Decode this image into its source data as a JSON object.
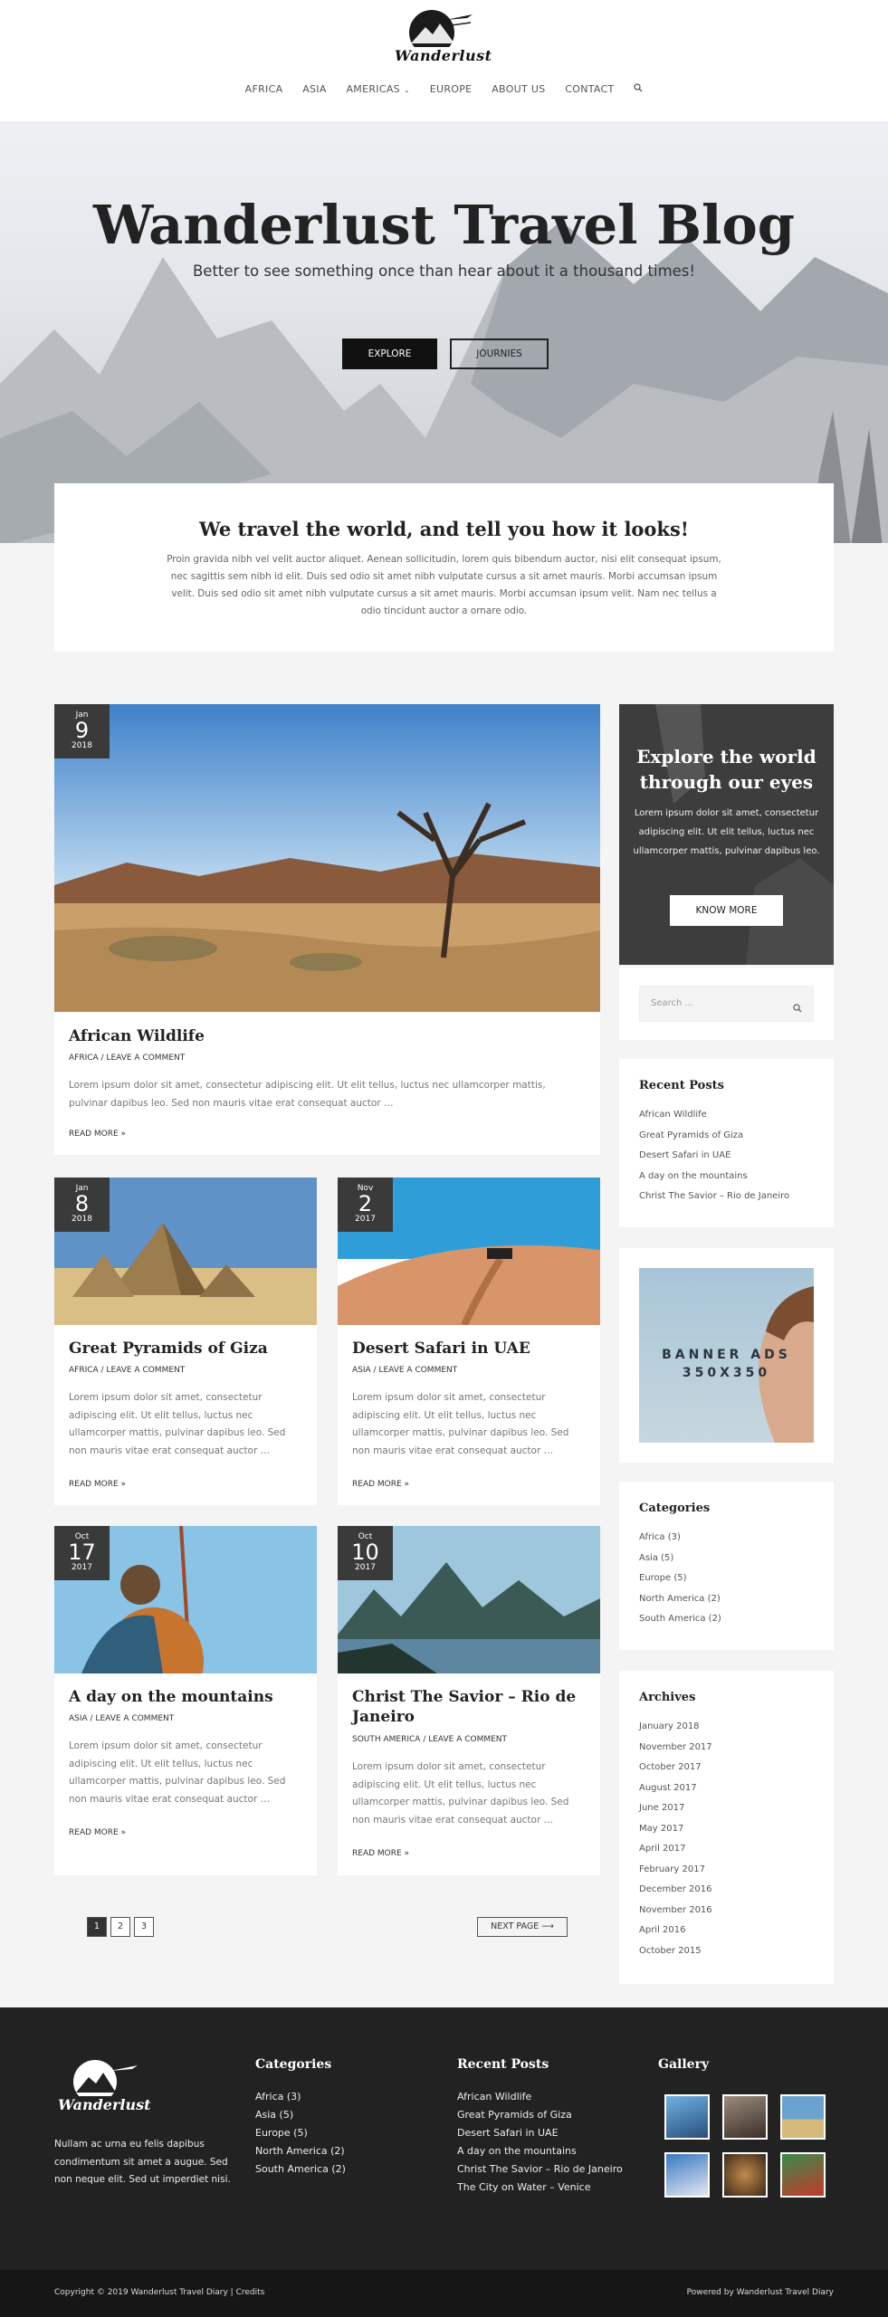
{
  "header": {
    "logo_text": "Wanderlust",
    "nav": [
      {
        "label": "AFRICA"
      },
      {
        "label": "ASIA"
      },
      {
        "label": "AMERICAS"
      },
      {
        "label": "EUROPE"
      },
      {
        "label": "ABOUT US"
      },
      {
        "label": "CONTACT"
      }
    ]
  },
  "hero": {
    "title": "Wanderlust Travel Blog",
    "subtitle": "Better to see something once than hear about it a thousand times!",
    "btn_primary": "EXPLORE",
    "btn_secondary": "JOURNIES"
  },
  "intro": {
    "title": "We travel the world, and tell you how it looks!",
    "text": "Proin gravida nibh vel velit auctor aliquet. Aenean sollicitudin, lorem quis bibendum auctor, nisi elit consequat ipsum, nec sagittis sem nibh id elit. Duis sed odio sit amet nibh vulputate cursus a sit amet mauris. Morbi accumsan ipsum velit. Duis sed odio sit amet nibh vulputate cursus a sit amet mauris. Morbi accumsan ipsum velit. Nam nec tellus a odio tincidunt auctor a ornare odio."
  },
  "posts": [
    {
      "month": "Jan",
      "day": "9",
      "year": "2018",
      "title": "African Wildlife",
      "meta": "AFRICA / LEAVE A COMMENT",
      "excerpt": "Lorem ipsum dolor sit amet, consectetur adipiscing elit. Ut elit tellus, luctus nec ullamcorper mattis, pulvinar dapibus leo. Sed non mauris vitae erat consequat auctor …",
      "read_more": "READ MORE »"
    },
    {
      "month": "Jan",
      "day": "8",
      "year": "2018",
      "title": "Great Pyramids of Giza",
      "meta": "AFRICA / LEAVE A COMMENT",
      "excerpt": "Lorem ipsum dolor sit amet, consectetur adipiscing elit. Ut elit tellus, luctus nec ullamcorper mattis, pulvinar dapibus leo. Sed non mauris vitae erat consequat auctor …",
      "read_more": "READ MORE »"
    },
    {
      "month": "Nov",
      "day": "2",
      "year": "2017",
      "title": "Desert Safari in UAE",
      "meta": "ASIA / LEAVE A COMMENT",
      "excerpt": "Lorem ipsum dolor sit amet, consectetur adipiscing elit. Ut elit tellus, luctus nec ullamcorper mattis, pulvinar dapibus leo. Sed non mauris vitae erat consequat auctor …",
      "read_more": "READ MORE »"
    },
    {
      "month": "Oct",
      "day": "17",
      "year": "2017",
      "title": "A day on the mountains",
      "meta": "ASIA / LEAVE A COMMENT",
      "excerpt": "Lorem ipsum dolor sit amet, consectetur adipiscing elit. Ut elit tellus, luctus nec ullamcorper mattis, pulvinar dapibus leo. Sed non mauris vitae erat consequat auctor …",
      "read_more": "READ MORE »"
    },
    {
      "month": "Oct",
      "day": "10",
      "year": "2017",
      "title": "Christ The Savior – Rio de Janeiro",
      "meta": "SOUTH AMERICA / LEAVE A COMMENT",
      "excerpt": "Lorem ipsum dolor sit amet, consectetur adipiscing elit. Ut elit tellus, luctus nec ullamcorper mattis, pulvinar dapibus leo. Sed non mauris vitae erat consequat auctor …",
      "read_more": "READ MORE »"
    }
  ],
  "pagination": {
    "pages": [
      "1",
      "2",
      "3"
    ],
    "next": "NEXT PAGE ⟶"
  },
  "sidebar": {
    "promo": {
      "title": "Explore the world through our eyes",
      "text": "Lorem ipsum dolor sit amet, consectetur adipiscing elit. Ut elit tellus, luctus nec ullamcorper mattis, pulvinar dapibus leo.",
      "button": "KNOW MORE"
    },
    "search_placeholder": "Search ...",
    "recent_title": "Recent Posts",
    "recent": [
      "African Wildlife",
      "Great Pyramids of Giza",
      "Desert Safari in UAE",
      "A day on the mountains",
      "Christ The Savior – Rio de Janeiro"
    ],
    "banner": {
      "line1": "BANNER ADS",
      "line2": "350X350"
    },
    "categories_title": "Categories",
    "categories": [
      "Africa (3)",
      "Asia (5)",
      "Europe (5)",
      "North America (2)",
      "South America (2)"
    ],
    "archives_title": "Archives",
    "archives": [
      "January 2018",
      "November 2017",
      "October 2017",
      "August 2017",
      "June 2017",
      "May 2017",
      "April 2017",
      "February 2017",
      "December 2016",
      "November 2016",
      "April 2016",
      "October 2015"
    ]
  },
  "footer": {
    "about": "Nullam ac urna eu felis dapibus condimentum sit amet a augue. Sed non neque elit. Sed ut imperdiet nisi.",
    "categories_title": "Categories",
    "categories": [
      "Africa (3)",
      "Asia (5)",
      "Europe (5)",
      "North America (2)",
      "South America (2)"
    ],
    "recent_title": "Recent Posts",
    "recent": [
      "African Wildlife",
      "Great Pyramids of Giza",
      "Desert Safari in UAE",
      "A day on the mountains",
      "Christ The Savior – Rio de Janeiro",
      "The City on Water – Venice"
    ],
    "gallery_title": "Gallery",
    "copyright": "Copyright © 2019 Wanderlust Travel Diary | Credits",
    "powered": "Powered by Wanderlust Travel Diary"
  }
}
